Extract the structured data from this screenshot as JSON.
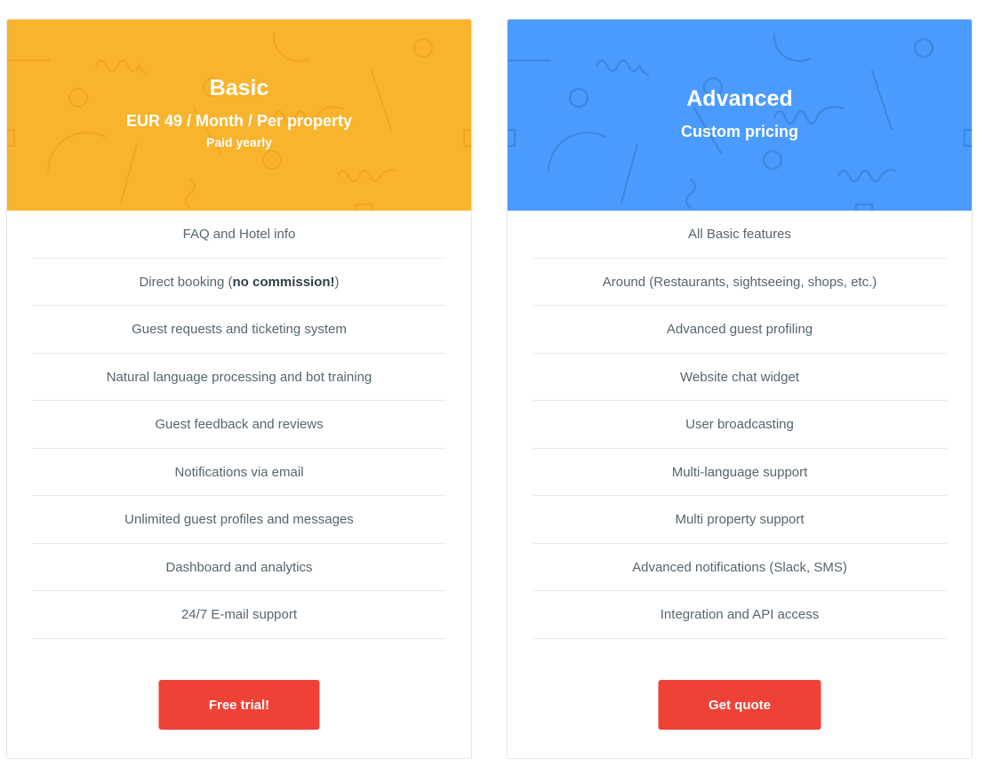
{
  "colors": {
    "basic_header": "#f9b42d",
    "advanced_header": "#4a9bfd",
    "cta_button": "#f04137",
    "feature_text": "#55666f",
    "divider": "#e4ebf1"
  },
  "plans": [
    {
      "name": "Basic",
      "price": "EUR 49 / Month / Per property",
      "note": "Paid yearly",
      "features": [
        "FAQ and Hotel info",
        {
          "prefix": "Direct booking (",
          "bold": "no commission!",
          "suffix": ")"
        },
        "Guest requests and ticketing system",
        "Natural language processing and bot training",
        "Guest feedback and reviews",
        "Notifications via email",
        "Unlimited guest profiles and messages",
        "Dashboard and analytics",
        "24/7 E-mail support"
      ],
      "cta_label": "Free trial!"
    },
    {
      "name": "Advanced",
      "price": "Custom pricing",
      "features": [
        "All Basic features",
        "Around (Restaurants, sightseeing, shops, etc.)",
        "Advanced guest profiling",
        "Website chat widget",
        "User broadcasting",
        "Multi-language support",
        "Multi property support",
        "Advanced notifications (Slack, SMS)",
        "Integration and API access"
      ],
      "cta_label": "Get quote"
    }
  ]
}
